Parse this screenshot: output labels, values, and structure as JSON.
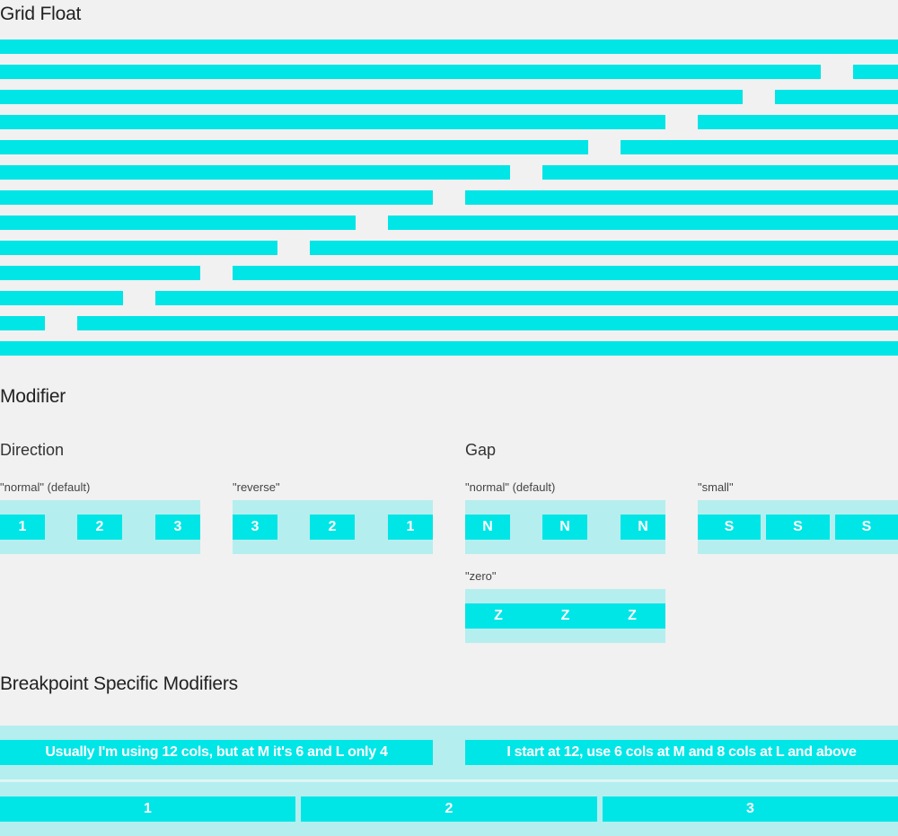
{
  "headings": {
    "grid_float": "Grid Float",
    "modifier": "Modifier",
    "direction": "Direction",
    "gap": "Gap",
    "breakpoint": "Breakpoint Specific Modifiers"
  },
  "direction": {
    "normal": {
      "label": "\"normal\" (default)",
      "cells": [
        "1",
        "2",
        "3"
      ]
    },
    "reverse": {
      "label": "\"reverse\"",
      "cells": [
        "3",
        "2",
        "1"
      ]
    }
  },
  "gap": {
    "normal": {
      "label": "\"normal\" (default)",
      "cells": [
        "N",
        "N",
        "N"
      ]
    },
    "small": {
      "label": "\"small\"",
      "cells": [
        "S",
        "S",
        "S"
      ]
    },
    "zero": {
      "label": "\"zero\"",
      "cells": [
        "Z",
        "Z",
        "Z"
      ]
    }
  },
  "breakpoint": {
    "row1": [
      "Usually I'm using 12 cols, but at M it's 6 and L only 4",
      "I start at 12, use 6 cols at M and 8 cols at L and above"
    ],
    "row2": [
      "1",
      "2",
      "3"
    ]
  },
  "colors": {
    "accent": "#00e5e6",
    "accent_light": "#b5eeee",
    "background": "#f1f1f1"
  }
}
